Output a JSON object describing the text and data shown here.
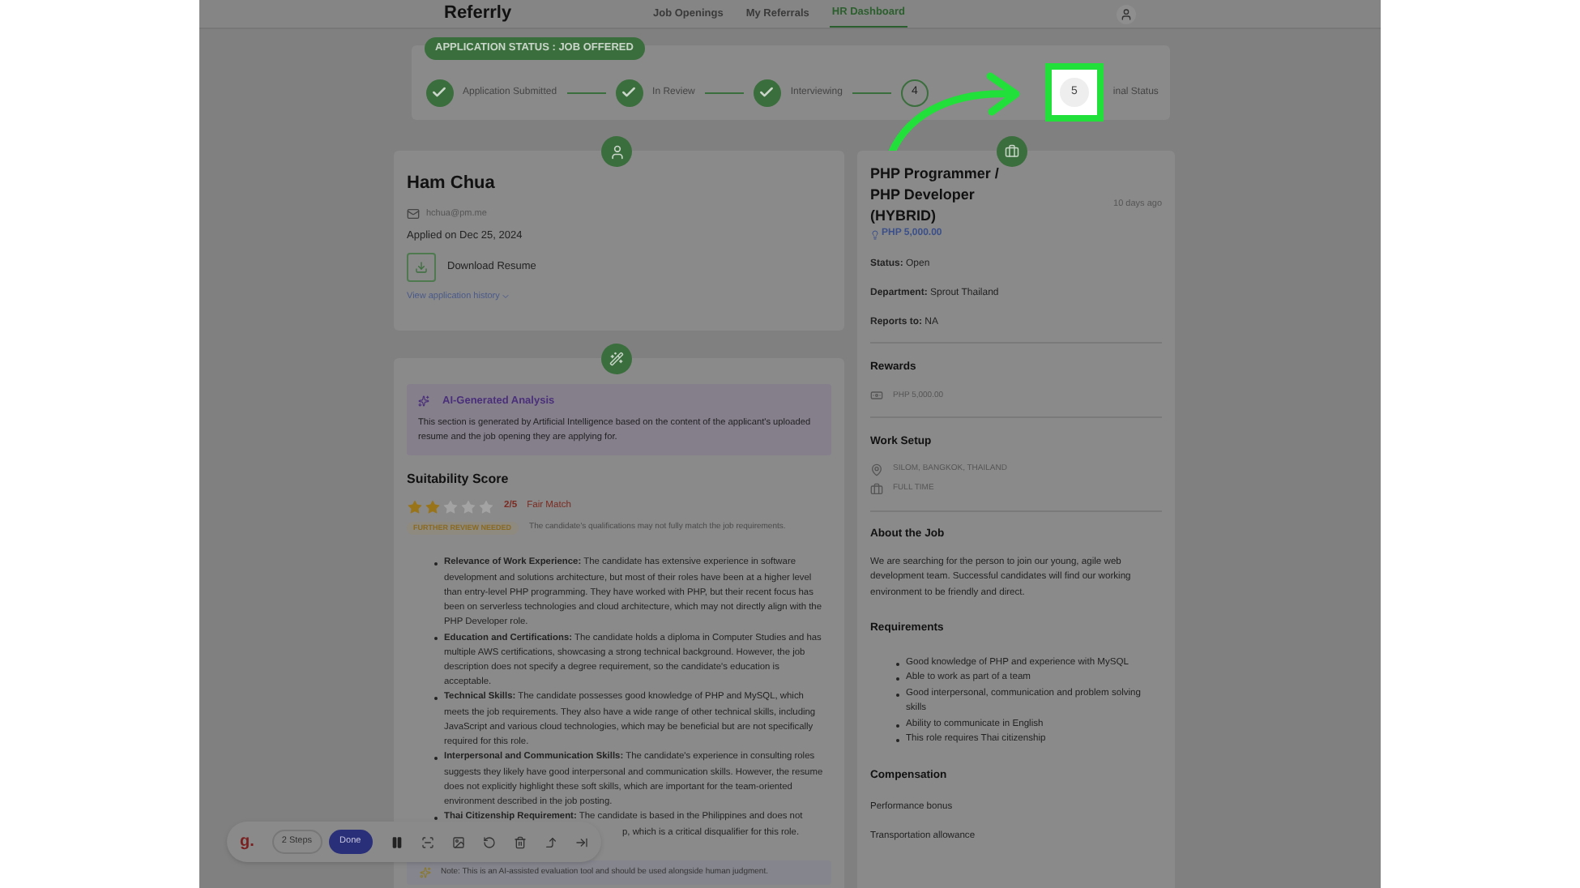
{
  "header": {
    "logo": "Referrly",
    "nav": [
      {
        "label": "Job Openings",
        "selected": false
      },
      {
        "label": "My Referrals",
        "selected": false
      },
      {
        "label": "HR Dashboard",
        "selected": true
      }
    ]
  },
  "status": {
    "badge": "APPLICATION STATUS : JOB OFFERED",
    "steps": [
      {
        "label": "Application Submitted",
        "done": true
      },
      {
        "label": "In Review",
        "done": true
      },
      {
        "label": "Interviewing",
        "done": true
      },
      {
        "marker": "4",
        "done": false
      },
      {
        "marker": "5",
        "label": "inal Status",
        "done": false,
        "highlighted": true
      }
    ]
  },
  "applicant": {
    "name": "Ham Chua",
    "email": "hchua@pm.me",
    "applied": "Applied on Dec 25, 2024",
    "download": "Download Resume",
    "history_link": "View application history"
  },
  "analysis": {
    "ai_title": "AI-Generated Analysis",
    "ai_text": "This section is generated by Artificial Intelligence based on the content of the applicant's uploaded resume and the job opening they are applying for.",
    "score_title": "Suitability Score",
    "stars": 2,
    "score": "2/5",
    "match": "Fair Match",
    "review_tag": "FURTHER REVIEW NEEDED",
    "review_text": "The candidate's qualifications may not fully match the job requirements.",
    "items": [
      {
        "label": "Relevance of Work Experience:",
        "text": "The candidate has extensive experience in software development and solutions architecture, but most of their roles have been at a higher level than entry-level PHP programming. They have worked with PHP, but their recent focus has been on serverless technologies and cloud architecture, which may not directly align with the PHP Developer role."
      },
      {
        "label": "Education and Certifications:",
        "text": "The candidate holds a diploma in Computer Studies and has multiple AWS certifications, showcasing a strong technical background. However, the job description does not specify a degree requirement, so the candidate's education is acceptable."
      },
      {
        "label": "Technical Skills:",
        "text": "The candidate possesses good knowledge of PHP and MySQL, which meets the job requirements. They also have a wide range of other technical skills, including JavaScript and various cloud technologies, which may be beneficial but are not specifically required for this role."
      },
      {
        "label": "Interpersonal and Communication Skills:",
        "text": "The candidate's experience in consulting roles suggests they likely have good interpersonal and communication skills. However, the resume does not explicitly highlight these soft skills, which are important for the team-oriented environment described in the job posting."
      },
      {
        "label": "Thai Citizenship Requirement:",
        "text": "The candidate is based in the Philippines and does not",
        "text_after_toolbar": "p, which is a critical disqualifier for this role."
      }
    ],
    "note": "Note: This is an AI-assisted evaluation tool and should be used alongside human judgment."
  },
  "job": {
    "title": "PHP Programmer / PHP Developer (HYBRID)",
    "posted": "10 days ago",
    "reward_amount": "PHP 5,000.00",
    "fields": [
      {
        "label": "Status:",
        "value": "Open"
      },
      {
        "label": "Department:",
        "value": "Sprout Thailand"
      },
      {
        "label": "Reports to:",
        "value": "NA"
      }
    ],
    "rewards_title": "Rewards",
    "reward": "PHP 5,000.00",
    "setup_title": "Work Setup",
    "location": "SILOM, BANGKOK, THAILAND",
    "type": "FULL TIME",
    "about_title": "About the Job",
    "about": "We are searching for the person to join our young, agile web development team. Successful candidates will find our working environment to be friendly and direct.",
    "req_title": "Requirements",
    "requirements": [
      "Good knowledge of PHP and experience with MySQL",
      "Able to work as part of a team",
      "Good interpersonal, communication and problem solving skills",
      "Ability to communicate in English",
      "This role requires Thai citizenship"
    ],
    "comp_title": "Compensation",
    "compensation": [
      "Performance bonus",
      "Transportation allowance"
    ]
  },
  "recorder": {
    "logo": "g.",
    "steps": "2 Steps",
    "done": "Done"
  }
}
